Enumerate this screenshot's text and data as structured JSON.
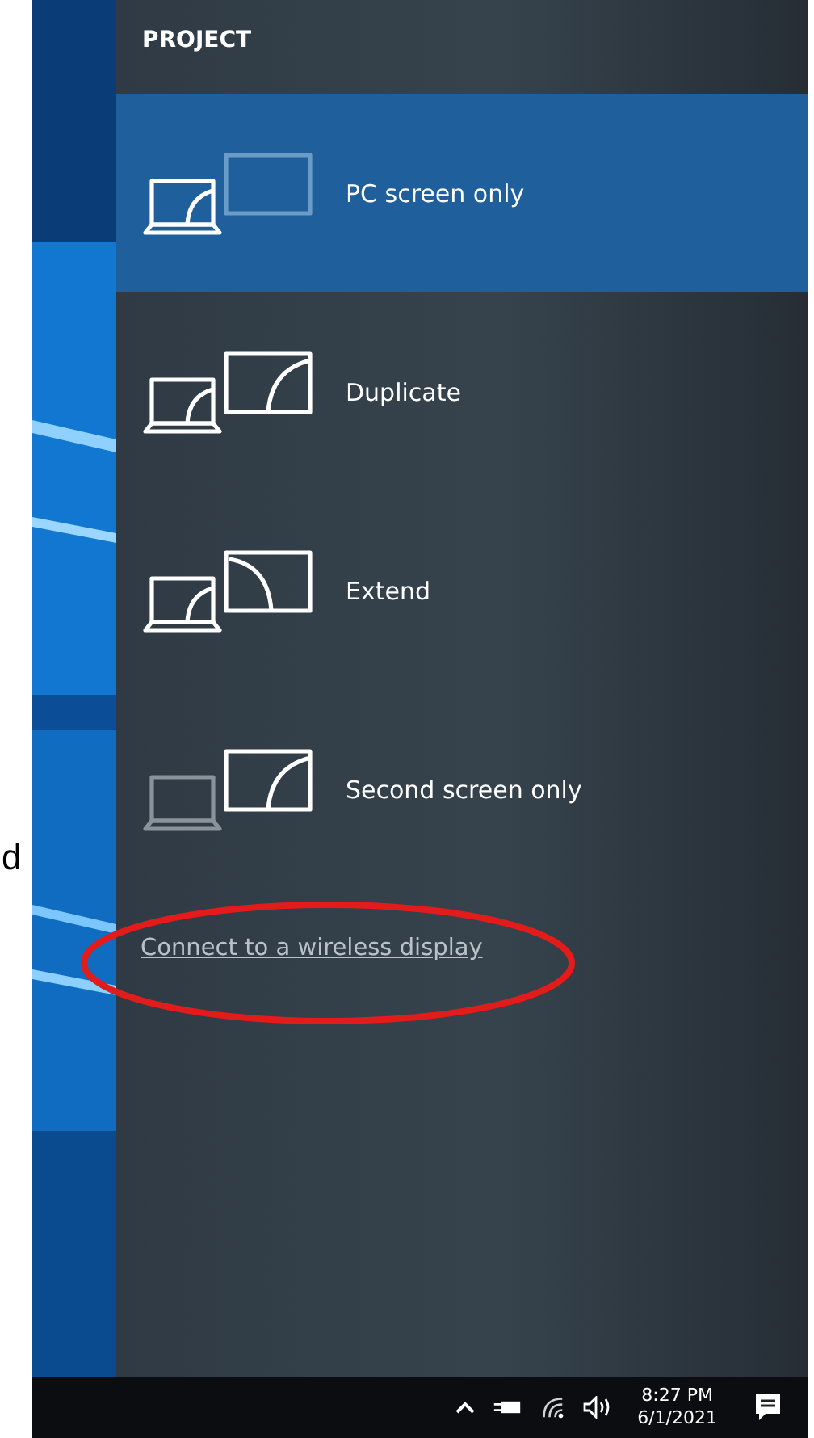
{
  "margin_text": "d",
  "panel": {
    "title": "PROJECT",
    "options": [
      {
        "kind": "pc_screen_only",
        "label": "PC screen only",
        "selected": true
      },
      {
        "kind": "duplicate",
        "label": "Duplicate",
        "selected": false
      },
      {
        "kind": "extend",
        "label": "Extend",
        "selected": false
      },
      {
        "kind": "second_screen_only",
        "label": "Second screen only",
        "selected": false
      }
    ],
    "link": "Connect to a wireless display"
  },
  "annotation": {
    "kind": "ellipse"
  },
  "taskbar": {
    "time": "8:27 PM",
    "date": "6/1/2021"
  }
}
